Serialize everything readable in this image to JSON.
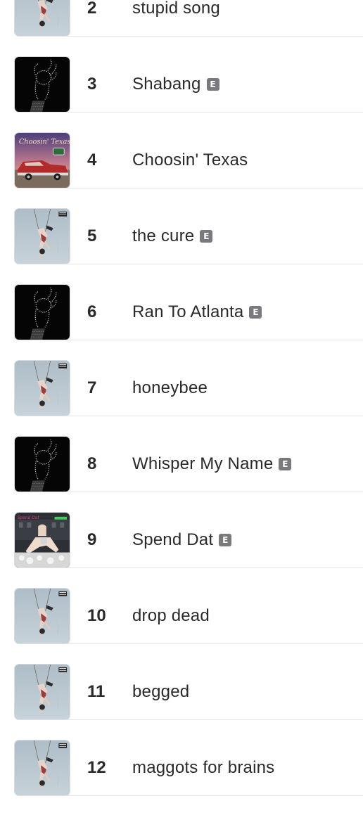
{
  "explicit_badge": "E",
  "tracks": [
    {
      "rank": "2",
      "title": "stupid song",
      "explicit": false,
      "artwork": "pale-blue-swing"
    },
    {
      "rank": "3",
      "title": "Shabang",
      "explicit": true,
      "artwork": "dark-ok-hand"
    },
    {
      "rank": "4",
      "title": "Choosin' Texas",
      "explicit": false,
      "artwork": "red-car-sunset"
    },
    {
      "rank": "5",
      "title": "the cure",
      "explicit": true,
      "artwork": "pale-blue-swing"
    },
    {
      "rank": "6",
      "title": "Ran To Atlanta",
      "explicit": true,
      "artwork": "dark-ok-hand"
    },
    {
      "rank": "7",
      "title": "honeybee",
      "explicit": false,
      "artwork": "pale-blue-swing"
    },
    {
      "rank": "8",
      "title": "Whisper My Name",
      "explicit": true,
      "artwork": "dark-ok-hand"
    },
    {
      "rank": "9",
      "title": "Spend Dat",
      "explicit": true,
      "artwork": "club-scene"
    },
    {
      "rank": "10",
      "title": "drop dead",
      "explicit": false,
      "artwork": "pale-blue-swing"
    },
    {
      "rank": "11",
      "title": "begged",
      "explicit": false,
      "artwork": "pale-blue-swing"
    },
    {
      "rank": "12",
      "title": "maggots for brains",
      "explicit": false,
      "artwork": "pale-blue-swing"
    }
  ],
  "art_text": {
    "red-car-sunset": "Choosin' Texas",
    "club-scene": "Spend Dat"
  }
}
